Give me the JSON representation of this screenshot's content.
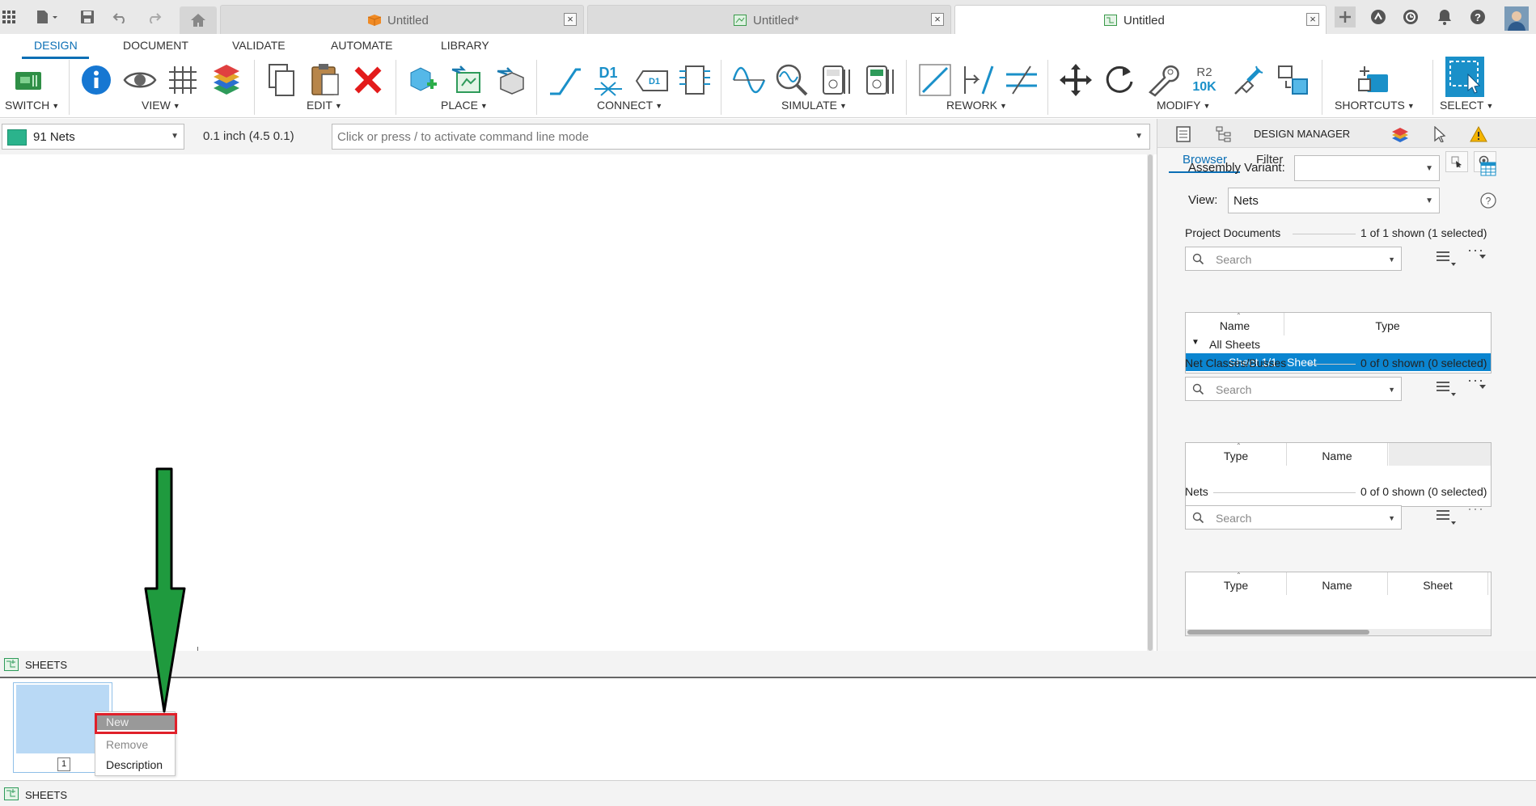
{
  "tabs": [
    {
      "label": "Untitled",
      "icon": "pcb-3d-icon"
    },
    {
      "label": "Untitled*",
      "icon": "board-icon"
    },
    {
      "label": "Untitled",
      "icon": "schematic-icon",
      "active": true
    }
  ],
  "ribbon_tabs": [
    "DESIGN",
    "DOCUMENT",
    "VALIDATE",
    "AUTOMATE",
    "LIBRARY"
  ],
  "ribbon_groups": {
    "switch": "SWITCH",
    "view": "VIEW",
    "edit": "EDIT",
    "place": "PLACE",
    "connect": "CONNECT",
    "simulate": "SIMULATE",
    "rework": "REWORK",
    "modify": "MODIFY",
    "shortcuts": "SHORTCUTS",
    "select": "SELECT"
  },
  "ribbon_icon_text": {
    "d1": "D1",
    "d1_box": "D1",
    "r2": "R2",
    "ten_k": "10K"
  },
  "cmdbar": {
    "net_selector": "91 Nets",
    "grid": "0.1 inch (4.5 0.1)",
    "command_placeholder": "Click or press / to activate command line mode"
  },
  "panel": {
    "title": "DESIGN MANAGER",
    "tabs": [
      "Browser",
      "Filter"
    ],
    "assembly_variant_label": "Assembly Variant:",
    "assembly_variant_value": "",
    "view_label": "View:",
    "view_value": "Nets",
    "sections": {
      "project_documents": {
        "title": "Project Documents",
        "count": "1 of 1 shown (1 selected)",
        "search_placeholder": "Search",
        "columns": [
          "Name",
          "Type"
        ],
        "rows": [
          {
            "name": "All Sheets",
            "type": ""
          },
          {
            "name": "Sheet 1/1",
            "type": "Sheet"
          }
        ]
      },
      "net_classes": {
        "title": "Net Classes/Busses",
        "count": "0 of 0 shown (0 selected)",
        "search_placeholder": "Search",
        "columns": [
          "Type",
          "Name"
        ]
      },
      "nets": {
        "title": "Nets",
        "count": "0 of 0 shown (0 selected)",
        "search_placeholder": "Search",
        "columns": [
          "Type",
          "Name",
          "Sheet"
        ]
      }
    }
  },
  "sheets": {
    "header": "SHEETS",
    "thumb_number": "1",
    "context_menu": [
      "New",
      "Remove",
      "Description"
    ],
    "bottom_label": "SHEETS"
  },
  "colors": {
    "accent": "#0b6fb5",
    "selection": "#0b85d0",
    "highlight_box": "#e0202a",
    "arrow": "#1f9a3e",
    "net_swatch": "#2bb38c"
  }
}
